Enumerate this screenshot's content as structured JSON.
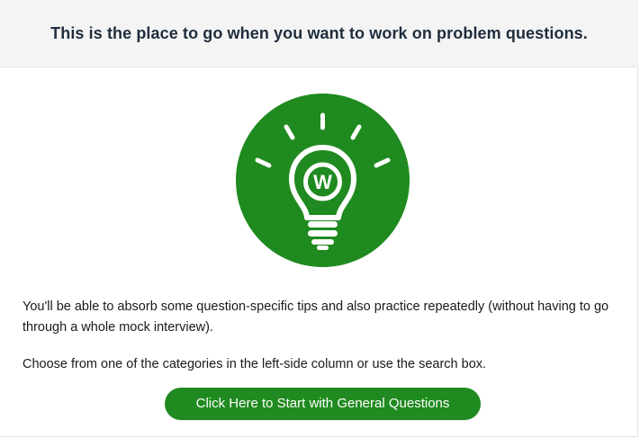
{
  "header": {
    "title": "This is the place to go when you want to work on problem questions."
  },
  "hero": {
    "icon": "lightbulb-icon",
    "logo_letter": "W",
    "circle_color": "#1f8a1f",
    "icon_color": "#ffffff"
  },
  "content": {
    "paragraph_1": "You'll be able to absorb some question-specific tips and also practice repeatedly (without having to go through a whole mock interview).",
    "paragraph_2": "Choose from one of the categories in the left-side column or use the search box."
  },
  "cta": {
    "label": "Click Here to Start with General Questions",
    "color": "#1f8a1f"
  }
}
